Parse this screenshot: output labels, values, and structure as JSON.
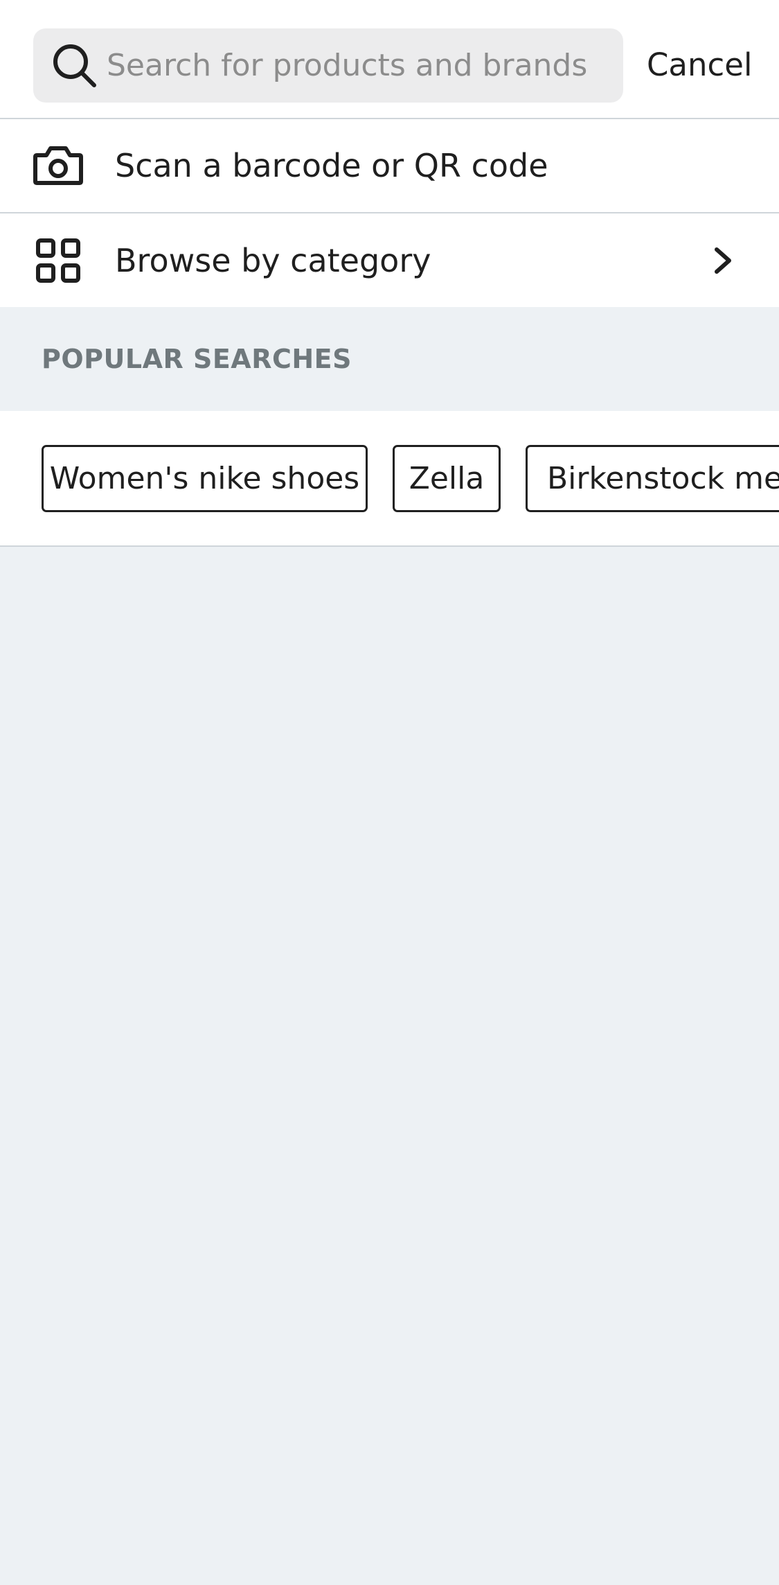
{
  "search": {
    "placeholder": "Search for products and brands",
    "value": "",
    "cancel_label": "Cancel"
  },
  "actions": {
    "scan_label": "Scan a barcode or QR code",
    "browse_label": "Browse by category"
  },
  "popular": {
    "title": "POPULAR SEARCHES",
    "chips": [
      "Women's nike shoes",
      "Zella",
      "Birkenstock men"
    ]
  },
  "icons": {
    "search": "search-icon",
    "camera": "camera-icon",
    "grid": "grid-icon",
    "chevron": "chevron-right-icon"
  },
  "colors": {
    "page_background": "#edf1f4",
    "search_field": "#ececed",
    "section_title": "#6f787c",
    "text": "#1f1f1f",
    "placeholder": "#8c8c8c"
  }
}
